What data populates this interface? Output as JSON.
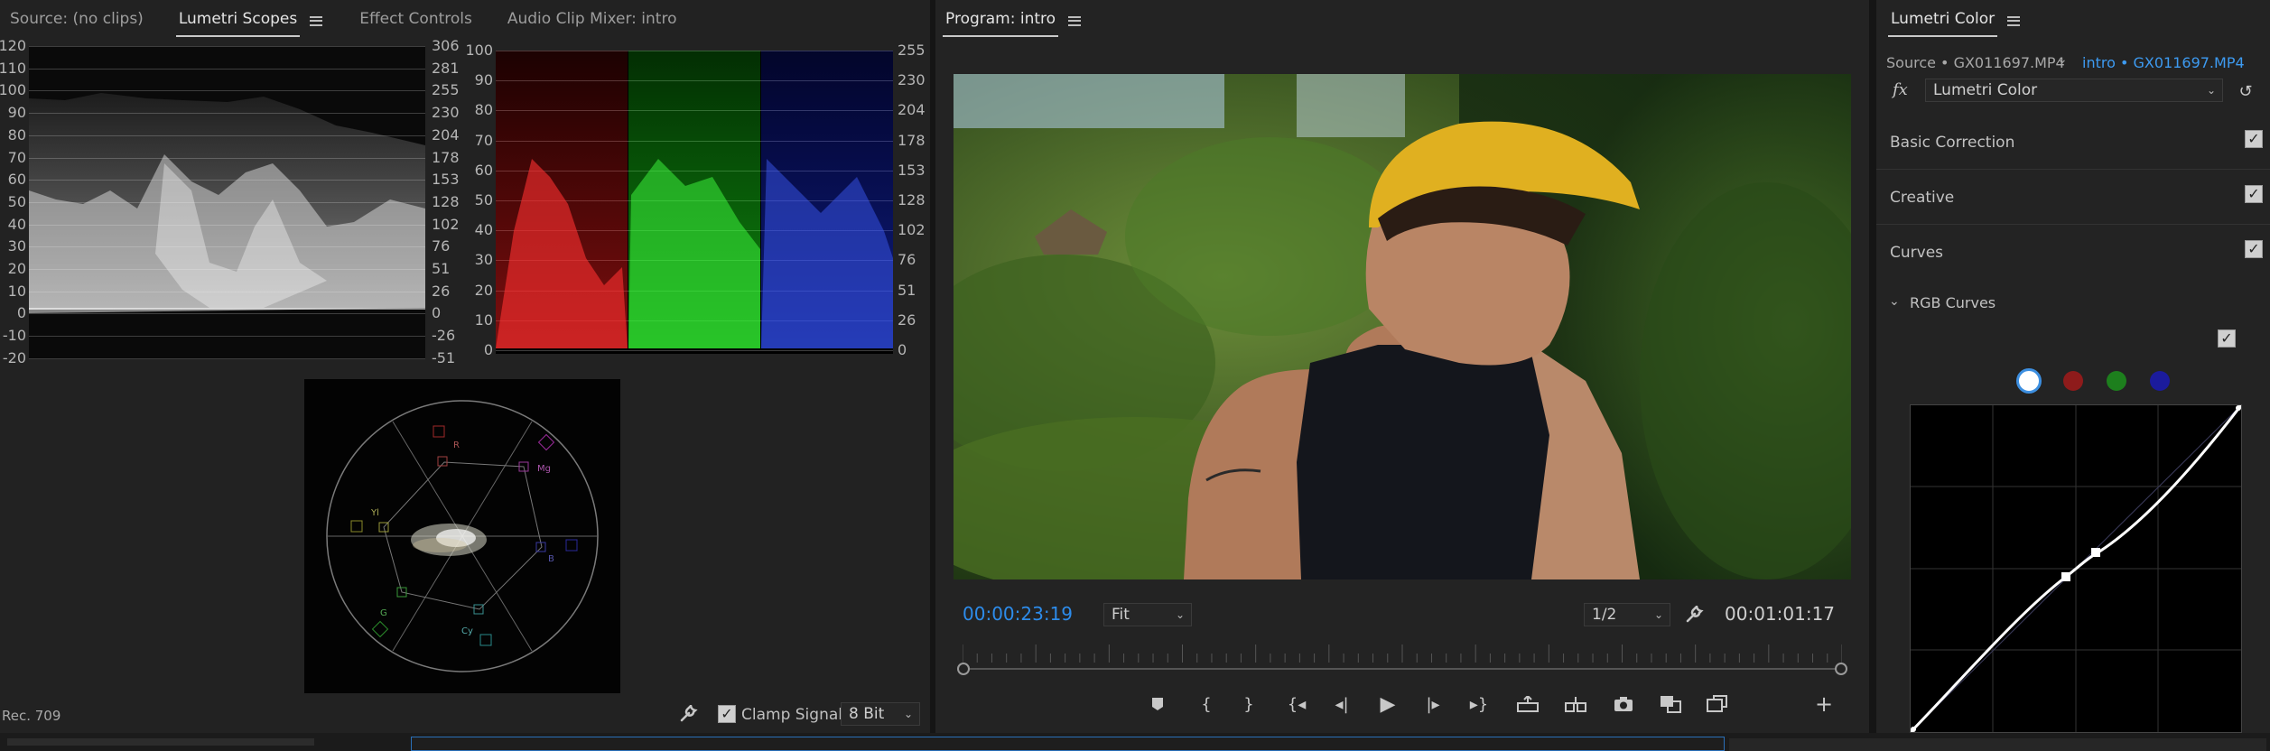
{
  "left_panel": {
    "tabs": [
      "Source: (no clips)",
      "Lumetri Scopes",
      "Effect Controls",
      "Audio Clip Mixer: intro"
    ],
    "active_tab": "Lumetri Scopes",
    "waveform_left_ticks": [
      "120",
      "110",
      "100",
      "90",
      "80",
      "70",
      "60",
      "50",
      "40",
      "30",
      "20",
      "10",
      "0",
      "-10",
      "-20"
    ],
    "waveform_right_ticks": [
      "306",
      "281",
      "255",
      "230",
      "204",
      "178",
      "153",
      "128",
      "102",
      "76",
      "51",
      "26",
      "0",
      "-26",
      "-51"
    ],
    "parade_left_ticks": [
      "100",
      "90",
      "80",
      "70",
      "60",
      "50",
      "40",
      "30",
      "20",
      "10",
      "0"
    ],
    "parade_right_ticks": [
      "255",
      "230",
      "204",
      "178",
      "153",
      "128",
      "102",
      "76",
      "51",
      "26",
      "0"
    ],
    "vectorscope_labels": {
      "r": "R",
      "mg": "Mg",
      "b": "B",
      "cy": "Cy",
      "g": "G",
      "yl": "Yl"
    },
    "footer_standard": "Rec. 709",
    "clamp_label": "Clamp Signal",
    "clamp_checked": true,
    "bit_depth": "8 Bit"
  },
  "program_panel": {
    "title": "Program: intro",
    "timecode": "00:00:23:19",
    "fit": "Fit",
    "resolution": "1/2",
    "duration": "00:01:01:17",
    "playhead_fraction": 0.38,
    "accent": "#2d8ceb"
  },
  "lumetri_panel": {
    "title": "Lumetri Color",
    "source": "Source • GX011697.MP4",
    "target": "intro • GX011697.MP4",
    "fx": "fx",
    "effect": "Lumetri Color",
    "sections": [
      "Basic Correction",
      "Creative",
      "Curves"
    ],
    "subsection": "RGB Curves",
    "channel_colors": [
      "#ffffff",
      "#8e1b1b",
      "#1d7f1d",
      "#1b1b9c"
    ]
  }
}
